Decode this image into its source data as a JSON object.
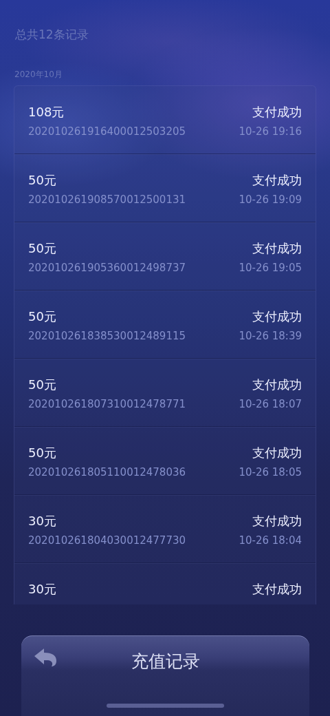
{
  "summary": "总共12条记录",
  "month": "2020年10月",
  "records": [
    {
      "amount": "108元",
      "status": "支付成功",
      "order_no": "202010261916400012503205",
      "time": "10-26 19:16"
    },
    {
      "amount": "50元",
      "status": "支付成功",
      "order_no": "202010261908570012500131",
      "time": "10-26 19:09"
    },
    {
      "amount": "50元",
      "status": "支付成功",
      "order_no": "202010261905360012498737",
      "time": "10-26 19:05"
    },
    {
      "amount": "50元",
      "status": "支付成功",
      "order_no": "202010261838530012489115",
      "time": "10-26 18:39"
    },
    {
      "amount": "50元",
      "status": "支付成功",
      "order_no": "202010261807310012478771",
      "time": "10-26 18:07"
    },
    {
      "amount": "50元",
      "status": "支付成功",
      "order_no": "202010261805110012478036",
      "time": "10-26 18:05"
    },
    {
      "amount": "30元",
      "status": "支付成功",
      "order_no": "202010261804030012477730",
      "time": "10-26 18:04"
    },
    {
      "amount": "30元",
      "status": "支付成功"
    }
  ],
  "bottom_bar": {
    "title": "充值记录"
  }
}
